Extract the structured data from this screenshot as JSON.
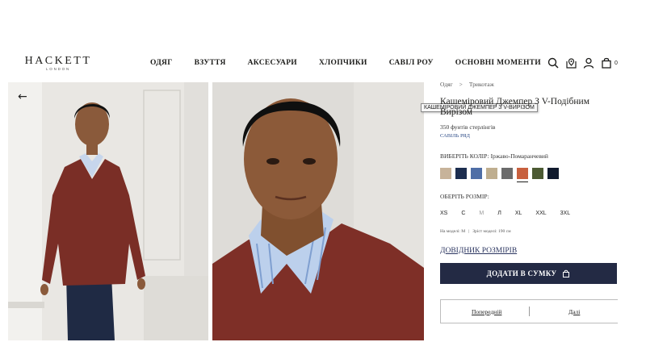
{
  "brand": {
    "name": "HACKETT",
    "sub": "LONDON"
  },
  "nav": [
    "ОДЯГ",
    "ВЗУТТЯ",
    "АКСЕСУАРИ",
    "ХЛОПЧИКИ",
    "САВІЛ РОУ",
    "ОСНОВНІ МОМЕНТИ"
  ],
  "header_icons": [
    "search-icon",
    "store-locator-icon",
    "account-icon",
    "bag-icon"
  ],
  "bag_count": "0",
  "breadcrumb": {
    "first": "Одяг",
    "separator": ">",
    "second": "Трикотаж"
  },
  "product": {
    "title": "Кашеміровий Джемпер З V-Подібним Вирізом",
    "tooltip": "КАШЕМІРОВИЙ ДЖЕМПЕР З V-ВИРІЗОМ",
    "price": "350 фунтів стерлінгів",
    "tag": "САВІЛЬ РЯД"
  },
  "color": {
    "label": "ВИБЕРІТЬ КОЛІР: Іржаво-Помаранчевий",
    "swatches": [
      "#c7b39a",
      "#1c2d4f",
      "#4f6ea6",
      "#bfae8f",
      "#6b6b6b",
      "#c8603e",
      "#4c5a33",
      "#101a2d"
    ],
    "selected_index": 5
  },
  "size": {
    "label": "ОБЕРІТЬ РОЗМІР:",
    "options": [
      "XS",
      "С",
      "М",
      "Л",
      "XL",
      "XXL",
      "3XL"
    ]
  },
  "model": {
    "size": "На моделі: М",
    "height": "Зріст моделі: 190 см"
  },
  "size_guide": "ДОВІДНИК РОЗМІРІВ",
  "add_to_bag": "ДОДАТИ В СУМКУ",
  "pager": {
    "prev": "Попередній",
    "next": "Далі"
  },
  "colors": {
    "button_bg": "#232a44",
    "sweater": "#7e2f27"
  }
}
